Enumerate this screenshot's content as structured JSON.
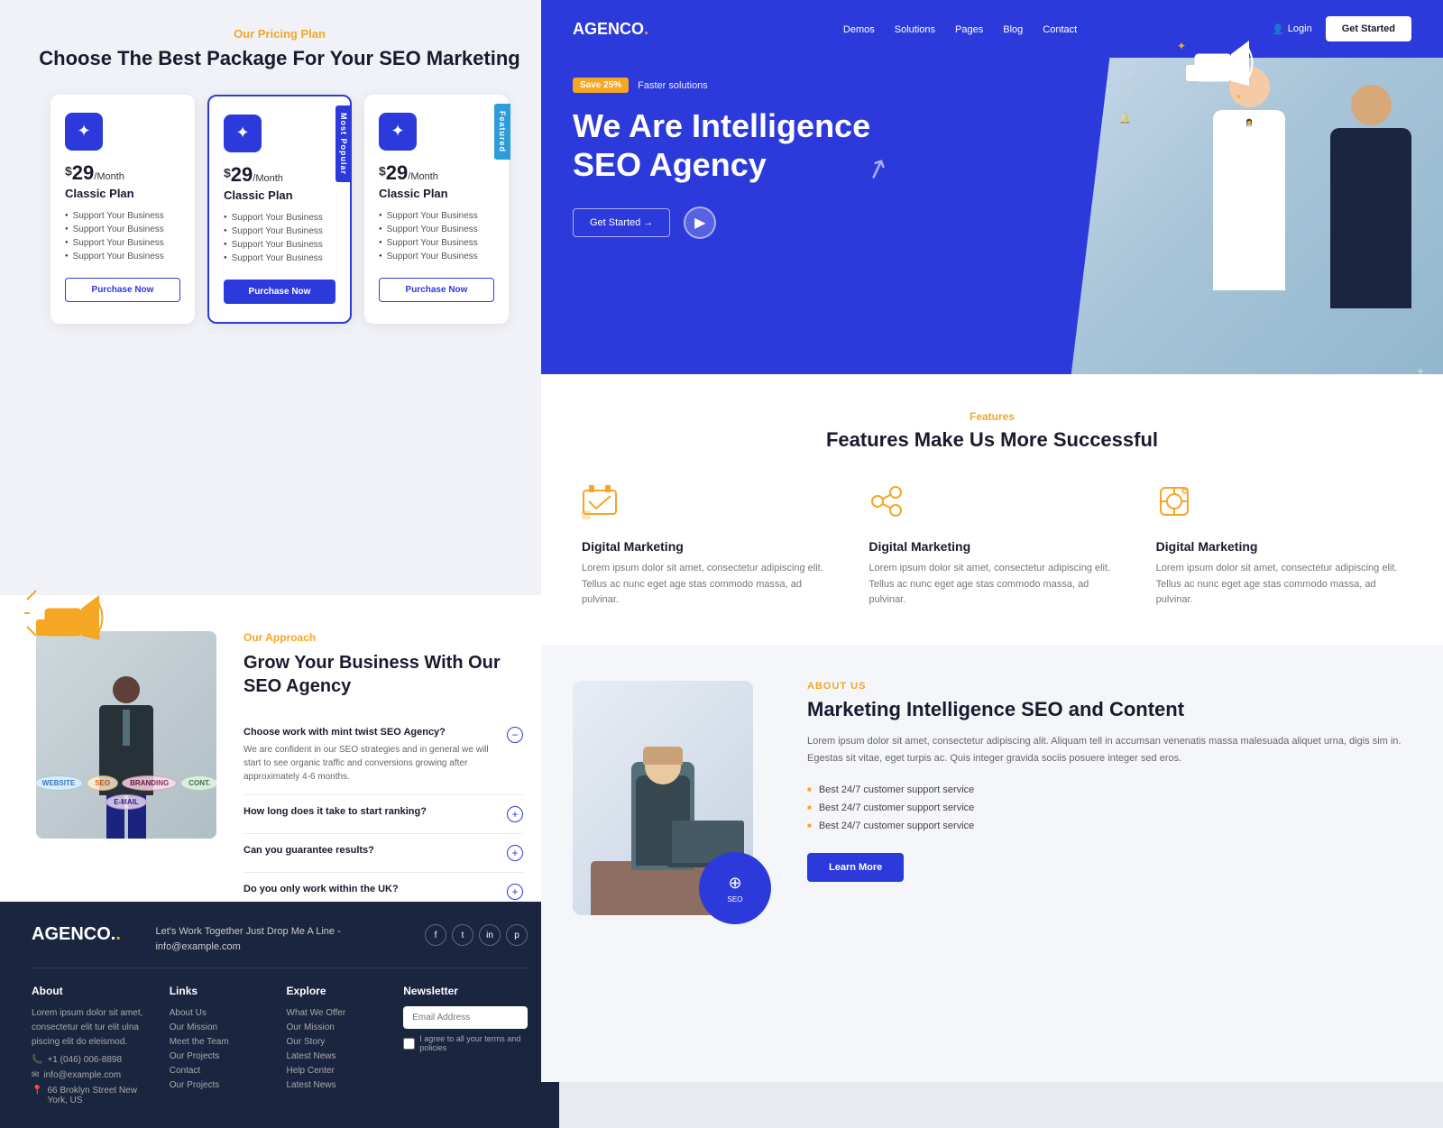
{
  "left": {
    "pricing": {
      "subtitle": "Our Pricing Plan",
      "title": "Choose The Best Package For Your SEO Marketing",
      "cards": [
        {
          "price": "29",
          "period": "/Month",
          "name": "Classic Plan",
          "features": [
            "Support Your Business",
            "Support Your Business",
            "Support Your Business",
            "Support Your Business"
          ],
          "btn": "Purchase Now",
          "badge": null,
          "variant": "outline"
        },
        {
          "price": "29",
          "period": "/Month",
          "name": "Classic Plan",
          "features": [
            "Support Your Business",
            "Support Your Business",
            "Support Your Business",
            "Support Your Business"
          ],
          "btn": "Purchase Now",
          "badge": "Most Popular",
          "variant": "filled"
        },
        {
          "price": "29",
          "period": "/Month",
          "name": "Classic Plan",
          "features": [
            "Support Your Business",
            "Support Your Business",
            "Support Your Business",
            "Support Your Business"
          ],
          "btn": "Purchase Now",
          "badge": "Featured",
          "variant": "outline"
        }
      ]
    },
    "approach": {
      "subtitle": "Our Approach",
      "title": "Grow Your Business With Our SEO Agency",
      "faqs": [
        {
          "question": "Choose work with mint twist SEO Agency?",
          "answer": "We are confident in our SEO strategies and in general we will start to see organic traffic and conversions growing after approximately 4-6 months.",
          "open": true
        },
        {
          "question": "How long does it take to start ranking?",
          "answer": "",
          "open": false
        },
        {
          "question": "Can you guarantee results?",
          "answer": "",
          "open": false
        },
        {
          "question": "Do you only work within the UK?",
          "answer": "",
          "open": false
        }
      ]
    },
    "footer": {
      "brand": "AGENCO.",
      "tagline_strong": "Let's Work Together Just Drop Me A Line - info@example.com",
      "about_title": "About",
      "about_text": "Lorem ipsum dolor sit amet, consectetur elit tur elit ulna piscing elit do eleismod.",
      "phone": "+1 (046) 006-8898",
      "email": "info@example.com",
      "address": "66 Broklyn Street New York, US",
      "links_title": "Links",
      "links": [
        "About Us",
        "Our Mission",
        "Meet the Team",
        "Our Projects",
        "Contact",
        "Our Projects"
      ],
      "explore_title": "Explore",
      "explore": [
        "What We Offer",
        "Our Mission",
        "Our Story",
        "Latest News",
        "Help Center",
        "Latest News"
      ],
      "newsletter_title": "Newsletter",
      "newsletter_placeholder": "Email Address",
      "newsletter_check": "I agree to all your terms and policies",
      "socials": [
        "f",
        "t",
        "in",
        "p"
      ]
    }
  },
  "right": {
    "nav": {
      "brand": "AGENCO.",
      "links": [
        "Demos",
        "Solutions",
        "Pages",
        "Blog",
        "Contact"
      ],
      "login": "Login",
      "cta": "Get Started"
    },
    "hero": {
      "badge_save": "Save 25%",
      "badge_text": "Faster solutions",
      "title": "We Are Intelligence SEO Agency",
      "cta": "Get Started →",
      "play": "▶"
    },
    "features": {
      "subtitle": "Features",
      "title": "Features Make Us More Successful",
      "items": [
        {
          "name": "Digital Marketing",
          "icon": "📊",
          "desc": "Lorem ipsum dolor sit amet, consectetur adipiscing elit. Tellus ac nunc eget age stas commodo massa, ad pulvinar."
        },
        {
          "name": "Digital Marketing",
          "icon": "🔗",
          "desc": "Lorem ipsum dolor sit amet, consectetur adipiscing elit. Tellus ac nunc eget age stas commodo massa, ad pulvinar."
        },
        {
          "name": "Digital Marketing",
          "icon": "⚙️",
          "desc": "Lorem ipsum dolor sit amet, consectetur adipiscing elit. Tellus ac nunc eget age stas commodo massa, ad pulvinar."
        }
      ]
    },
    "about": {
      "subtitle": "ABOUT US",
      "title": "Marketing Intelligence SEO and Content",
      "desc": "Lorem ipsum dolor sit amet, consectetur adipiscing alit. Aliquam tell in accumsan venenatis massa malesuada aliquet urna, digis sim in. Egestas sit vitae, eget turpis ac. Quis integer gravida sociis posuere integer sed eros.",
      "list": [
        "Best 24/7 customer support service",
        "Best 24/7 customer support service",
        "Best 24/7 customer support service"
      ],
      "cta": "Learn More"
    }
  }
}
